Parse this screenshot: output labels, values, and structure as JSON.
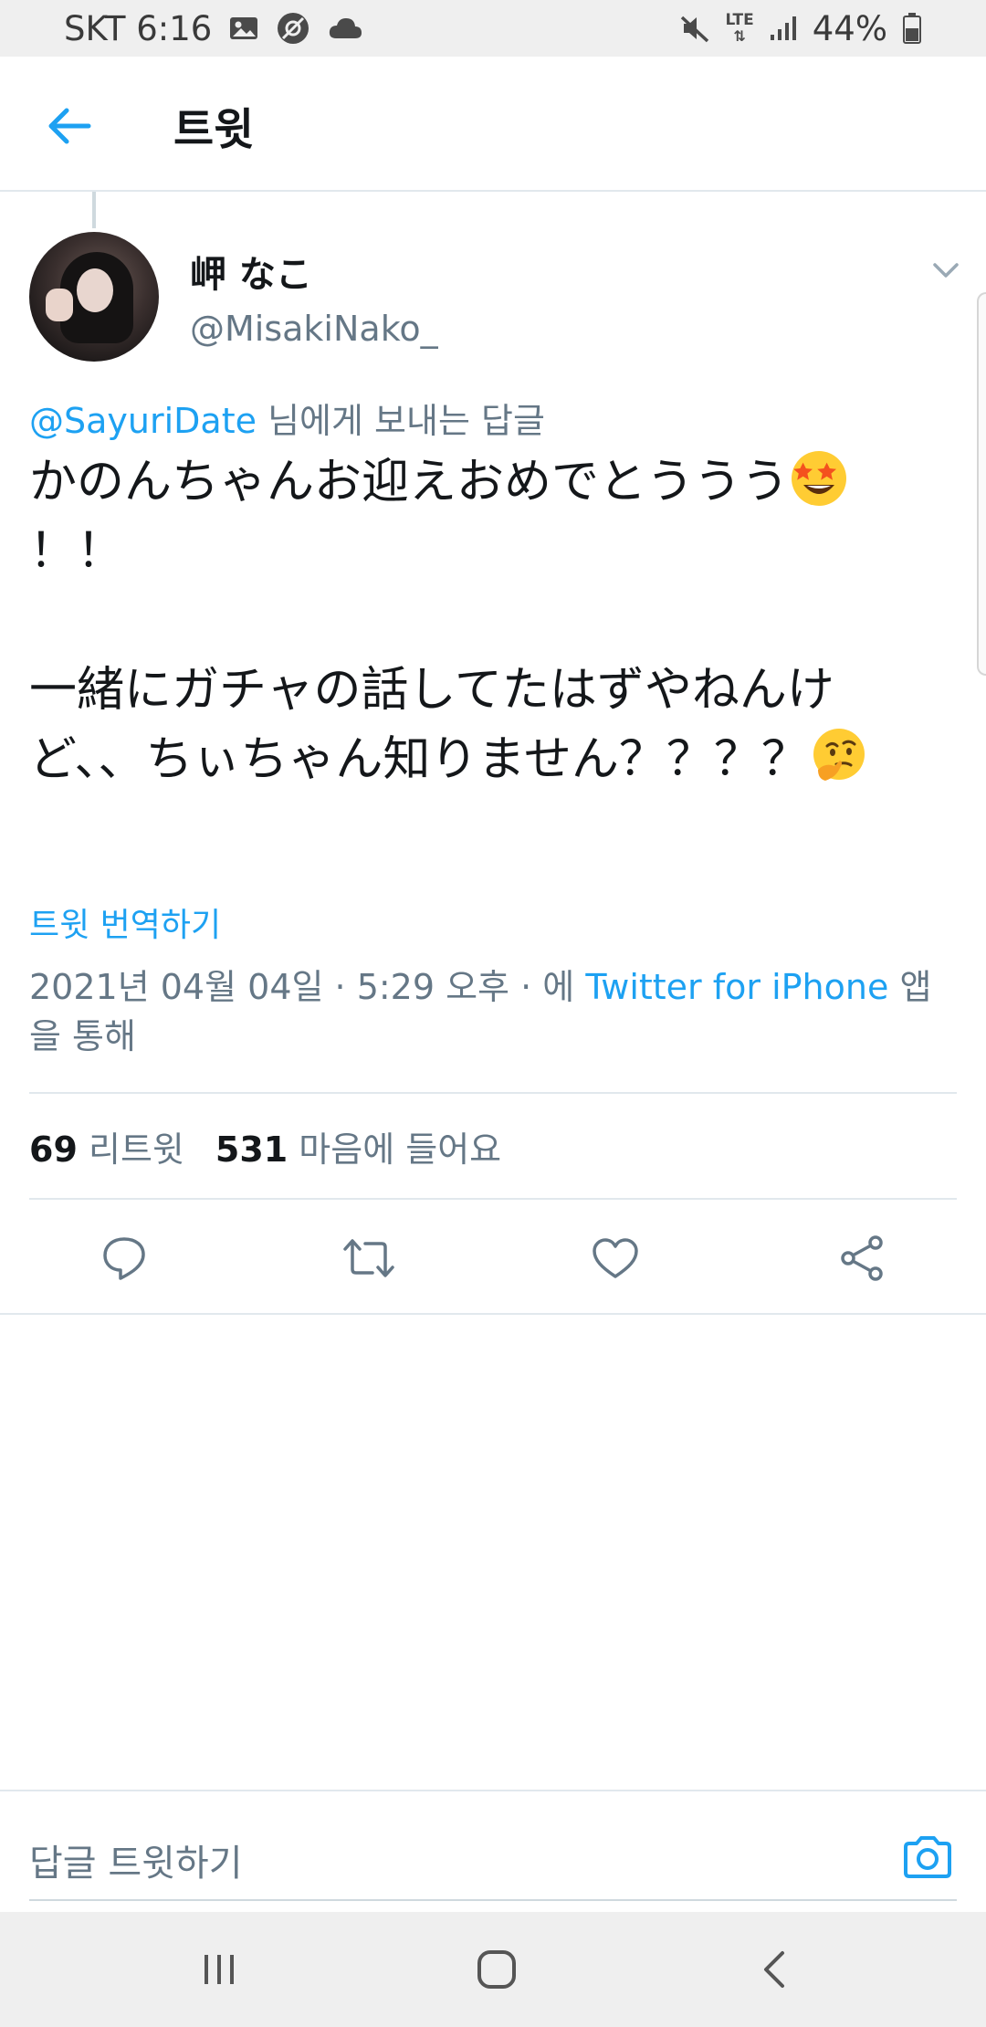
{
  "status_bar": {
    "carrier_time": "SKT 6:16",
    "network": "LTE",
    "battery": "44%"
  },
  "header": {
    "title": "트윗"
  },
  "tweet": {
    "display_name": "岬 なこ",
    "handle": "@MisakiNako_",
    "reply_mention": "@SayuriDate",
    "reply_suffix": " 님에게 보내는 답글",
    "text_line1": "かのんちゃんお迎えおめでとううう",
    "text_line1b": "！！",
    "text_line2": "一緒にガチャの話してたはずやねんけど、、ちぃちゃん知りません？？？？",
    "translate_label": "트윗 번역하기",
    "timestamp": "2021년 04월 04일 · 5:29 오후 · 에 ",
    "source": "Twitter for iPhone",
    "source_suffix": " 앱을 통해",
    "retweet_count": "69",
    "retweet_label": "리트윗",
    "like_count": "531",
    "like_label": "마음에 들어요"
  },
  "reply_bar": {
    "placeholder": "답글 트윗하기"
  },
  "icons": {
    "back": "arrow-left-icon",
    "more": "chevron-down-icon",
    "reply": "comment-icon",
    "retweet": "retweet-icon",
    "like": "heart-icon",
    "share": "share-icon",
    "camera": "camera-icon",
    "emoji1": "star-struck-emoji",
    "emoji2": "thinking-face-emoji"
  },
  "colors": {
    "accent": "#1da1f2",
    "secondary_text": "#657786",
    "divider": "#e1e8ed"
  }
}
